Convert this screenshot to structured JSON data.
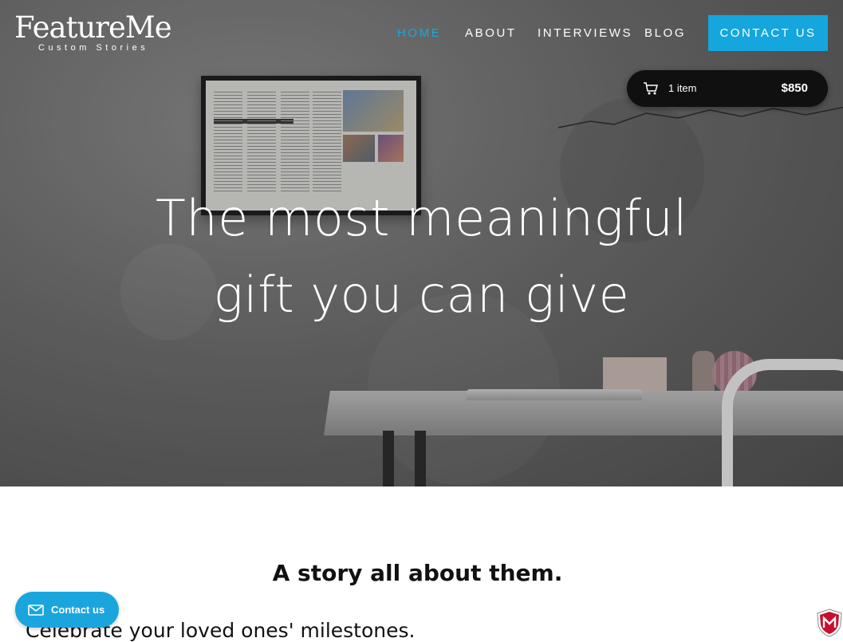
{
  "brand": {
    "name": "FeatureMe",
    "tagline": "Custom Stories"
  },
  "nav": {
    "items": [
      {
        "label": "HOME",
        "active": true
      },
      {
        "label": "ABOUT",
        "active": false
      },
      {
        "label": "INTERVIEWS",
        "active": false
      },
      {
        "label": "BLOG",
        "active": false
      }
    ],
    "cta_label": "CONTACT US"
  },
  "cart": {
    "icon": "shopping-cart-icon",
    "count_label": "1 item",
    "total": "$850"
  },
  "hero": {
    "line1": "The most meaningful",
    "line2": "gift you can give"
  },
  "section": {
    "title": "A story all about them.",
    "line": "Celebrate your loved ones' milestones."
  },
  "contact_widget": {
    "icon": "mail-icon",
    "label": "Contact us"
  },
  "badge": {
    "icon": "mcafee-shield-icon"
  },
  "colors": {
    "accent": "#14a6dc",
    "active_nav": "#1aa7d6",
    "cart_bg": "#101010"
  }
}
